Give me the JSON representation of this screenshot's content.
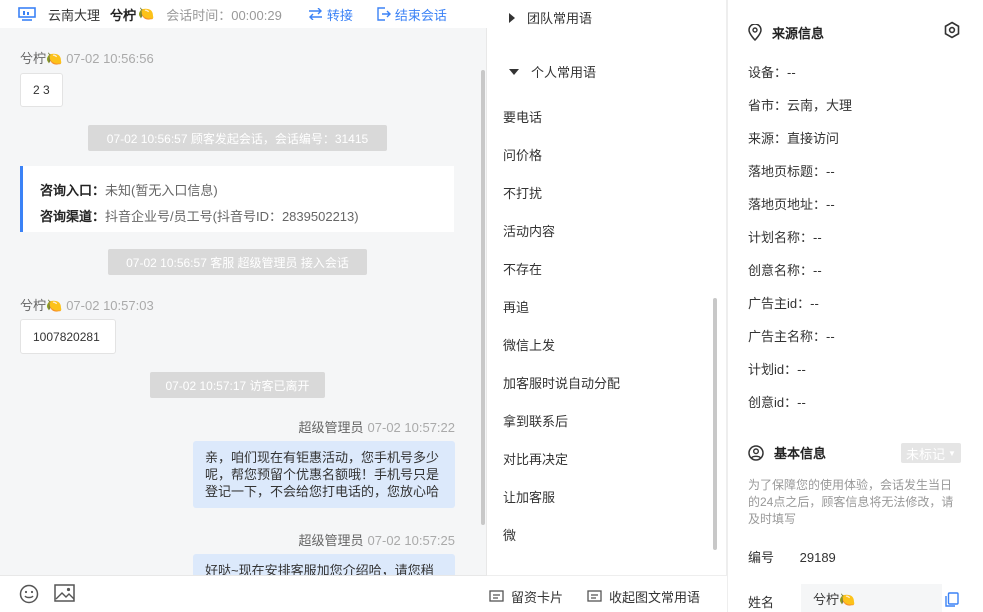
{
  "header": {
    "location": "云南大理",
    "visitor_name": "兮柠",
    "emoji": "🍋",
    "timer": "会话时间：00:00:29",
    "transfer": "转接",
    "end_session": "结束会话"
  },
  "chat": {
    "msg1_sender": "兮柠",
    "msg1_emoji": "🍋",
    "msg1_time": "07-02 10:56:56",
    "msg1_text": "2 3",
    "sys1": "07-02 10:56:57 顾客发起会话，会话编号：31415",
    "src_entry_label": "咨询入口：",
    "src_entry_value": "未知(暂无入口信息)",
    "src_channel_label": "咨询渠道：",
    "src_channel_value": "抖音企业号/员工号(抖音号ID：2839502213)",
    "sys2": "07-02 10:56:57 客服 超级管理员 接入会话",
    "msg2_sender": "兮柠",
    "msg2_emoji": "🍋",
    "msg2_time": "07-02 10:57:03",
    "msg2_text": "1007820281",
    "sys3": "07-02 10:57:17 访客已离开",
    "msg3_sender": "超级管理员",
    "msg3_time": "07-02 10:57:22",
    "msg3_text": "亲，咱们现在有钜惠活动，您手机号多少呢，帮您预留个优惠名额哦！手机号只是登记一下，不会给您打电话的，您放心哈",
    "msg4_sender": "超级管理员",
    "msg4_time": "07-02 10:57:25",
    "msg4_text": "好哒~现在安排客服加您介绍哈，请您稍"
  },
  "phrases": {
    "team_group": "团队常用语",
    "personal_group": "个人常用语",
    "items": [
      "要电话",
      "问价格",
      "不打扰",
      "活动内容",
      "不存在",
      "再追",
      "微信上发",
      "加客服时说自动分配",
      "拿到联系后",
      "对比再决定",
      "让加客服",
      "微"
    ],
    "footer_card": "留资卡片",
    "footer_rich": "收起图文常用语"
  },
  "source_info": {
    "title": "来源信息",
    "rows": [
      "设备：--",
      "省市：云南，大理",
      "来源：直接访问",
      "落地页标题：--",
      "落地页地址：--",
      "计划名称：--",
      "创意名称：--",
      "广告主id：--",
      "广告主名称：--",
      "计划id：--",
      "创意id：--"
    ]
  },
  "basic_info": {
    "title": "基本信息",
    "tag": "未标记",
    "hint": "为了保障您的使用体验，会话发生当日的24点之后，顾客信息将无法修改，请及时填写",
    "id_label": "编号",
    "id_value": "29189",
    "name_label": "姓名",
    "name_value": "兮柠🍋"
  },
  "colors": {
    "accent": "#3b82f6",
    "agent_bubble": "#dce9fb",
    "system_pill": "#d9d9d9"
  }
}
